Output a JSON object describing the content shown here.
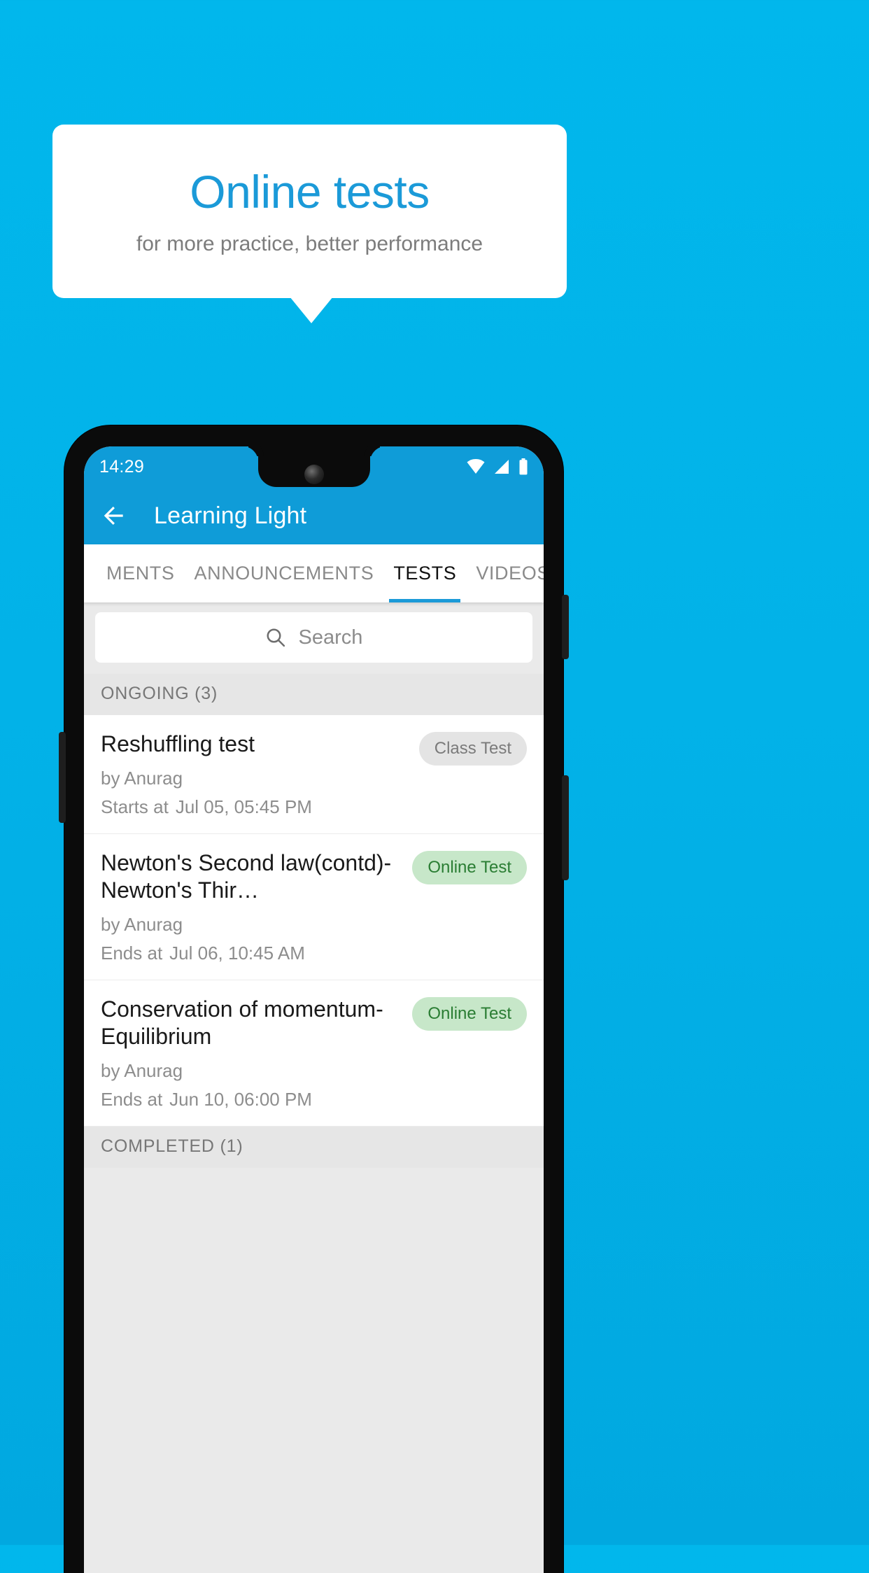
{
  "promo": {
    "title": "Online tests",
    "subtitle": "for more practice, better performance",
    "accent_color": "#1b9ad8",
    "background_color": "#01b2e8"
  },
  "phone": {
    "statusbar": {
      "time": "14:29",
      "icons": [
        "wifi-icon",
        "cellular-signal-icon",
        "battery-icon"
      ],
      "background_color": "#0f9cd8"
    },
    "appbar": {
      "back_icon": "back-arrow-icon",
      "title": "Learning Light",
      "background_color": "#0f9cd8"
    },
    "tabs": [
      {
        "label": "MENTS",
        "active": false
      },
      {
        "label": "ANNOUNCEMENTS",
        "active": false
      },
      {
        "label": "TESTS",
        "active": true
      },
      {
        "label": "VIDEOS",
        "active": false
      }
    ],
    "search": {
      "icon": "search-icon",
      "placeholder": "Search",
      "value": ""
    },
    "sections": [
      {
        "header": "ONGOING (3)",
        "items": [
          {
            "title": "Reshuffling test",
            "author": "by Anurag",
            "time_label": "Starts at",
            "time_value": "Jul 05, 05:45 PM",
            "badge": "Class Test",
            "badge_style": "gray"
          },
          {
            "title": "Newton's Second law(contd)-Newton's Thir…",
            "author": "by Anurag",
            "time_label": "Ends at",
            "time_value": "Jul 06, 10:45 AM",
            "badge": "Online Test",
            "badge_style": "green"
          },
          {
            "title": "Conservation of momentum-Equilibrium",
            "author": "by Anurag",
            "time_label": "Ends at",
            "time_value": "Jun 10, 06:00 PM",
            "badge": "Online Test",
            "badge_style": "green"
          }
        ]
      },
      {
        "header": "COMPLETED (1)",
        "items": []
      }
    ]
  }
}
